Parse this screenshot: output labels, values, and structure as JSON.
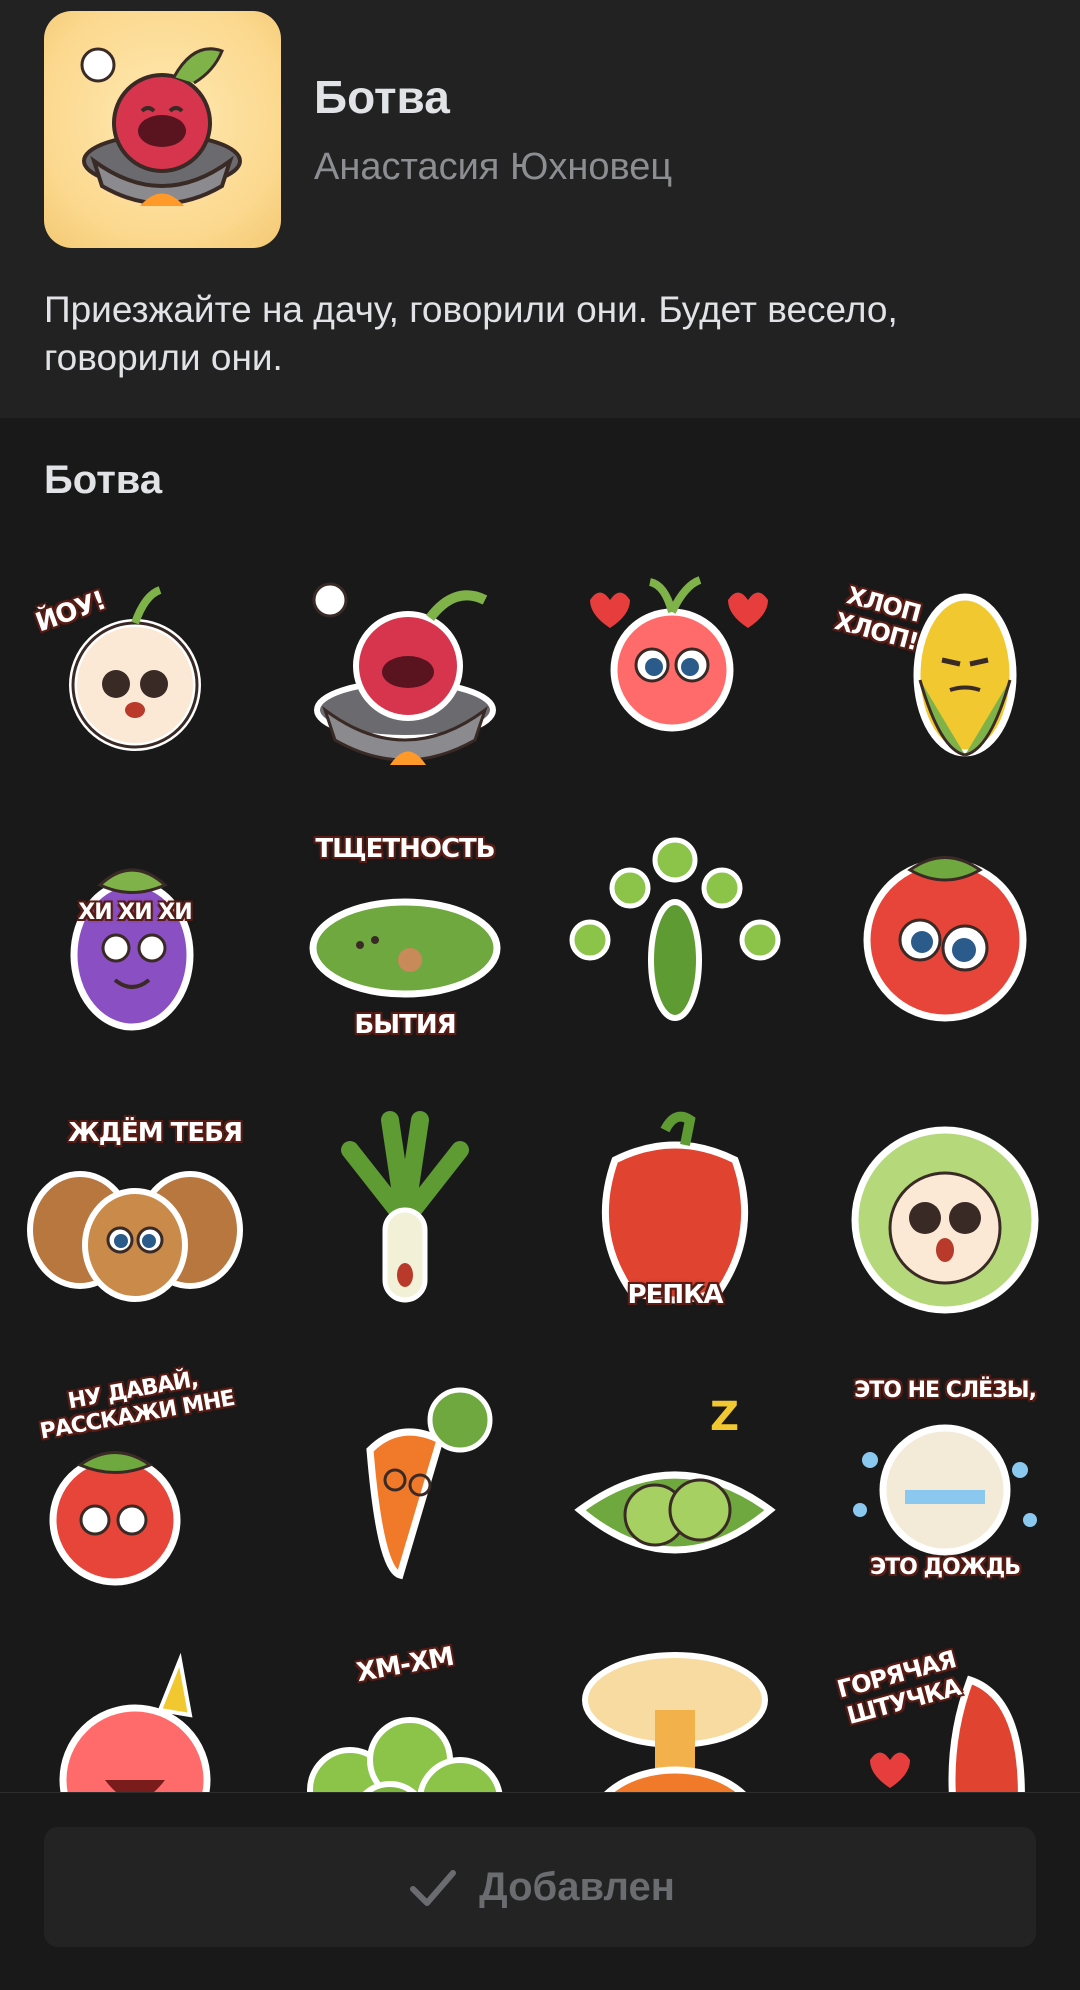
{
  "pack": {
    "title": "Ботва",
    "author": "Анастасия Юхновец",
    "description": "Приезжайте на дачу, говорили они. Будет весело, говорили они."
  },
  "section": {
    "title": "Ботва"
  },
  "stickers": [
    {
      "name": "onion",
      "caption": "ЙОУ!"
    },
    {
      "name": "beet-in-pot",
      "caption": ""
    },
    {
      "name": "radish-hearts",
      "caption": ""
    },
    {
      "name": "corn-clapping",
      "caption": "ХЛОП ХЛОП!"
    },
    {
      "name": "eggplant-laughing",
      "caption": "ХИ ХИ ХИ"
    },
    {
      "name": "cucumber",
      "caption_top": "ТЩЕТНОСТЬ",
      "caption_bottom": "БЫТИЯ"
    },
    {
      "name": "peas-meditating",
      "caption": ""
    },
    {
      "name": "tomato",
      "caption": ""
    },
    {
      "name": "potatoes",
      "caption": "ЖДЁМ ТЕБЯ"
    },
    {
      "name": "leek",
      "caption": ""
    },
    {
      "name": "pepper",
      "caption": "РЕПКА"
    },
    {
      "name": "cabbage",
      "caption": ""
    },
    {
      "name": "tomato-talk",
      "caption": "НУ ДАВАЙ, РАССКАЖИ МНЕ"
    },
    {
      "name": "carrot",
      "caption": ""
    },
    {
      "name": "peapod-sleeping",
      "caption": ""
    },
    {
      "name": "onion-crying",
      "caption_top": "ЭТО НЕ СЛЁЗЫ,",
      "caption_bottom": "ЭТО ДОЖДЬ"
    },
    {
      "name": "radish-party",
      "caption": ""
    },
    {
      "name": "peas-hmm",
      "caption": "ХМ-ХМ"
    },
    {
      "name": "pumpkin-boom",
      "caption": ""
    },
    {
      "name": "chili-hot",
      "caption": "ГОРЯЧАЯ ШТУЧКА"
    }
  ],
  "footer": {
    "button_label": "Добавлен"
  },
  "colors": {
    "background": "#19191a",
    "header_bg": "#222223",
    "text_primary": "#e1e3e6",
    "text_secondary": "#8c8e92",
    "button_bg": "#232324",
    "button_text": "#6a6c70"
  }
}
